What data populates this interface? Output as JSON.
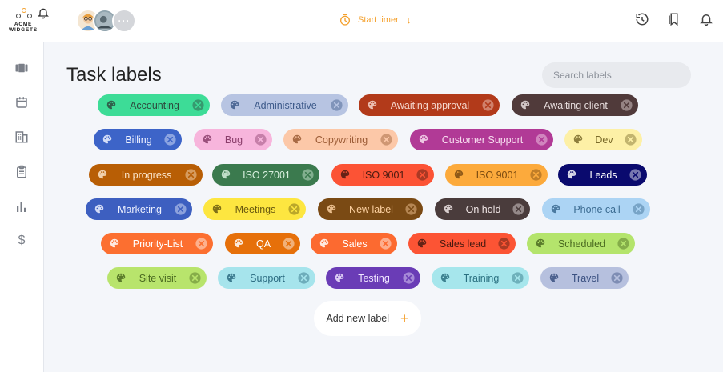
{
  "brand": {
    "line1": "ACME",
    "line2": "WIDGETS"
  },
  "header": {
    "timer_label": "Start timer",
    "avatars_more": "···"
  },
  "page": {
    "title": "Task labels"
  },
  "search": {
    "placeholder": "Search labels"
  },
  "add_label": {
    "text": "Add new label"
  },
  "labels": [
    {
      "name": "Accounting",
      "bg": "#3ddc97",
      "fg": "#2e4a3e"
    },
    {
      "name": "Administrative",
      "bg": "#b7c4e2",
      "fg": "#3d5a8a"
    },
    {
      "name": "Awaiting approval",
      "bg": "#b23a1a",
      "fg": "#f5d6cc"
    },
    {
      "name": "Awaiting client",
      "bg": "#503a3a",
      "fg": "#e8dede"
    },
    {
      "name": "Billing",
      "bg": "#3d64c8",
      "fg": "#eef2ff"
    },
    {
      "name": "Bug",
      "bg": "#f7b5dc",
      "fg": "#8a3d6a"
    },
    {
      "name": "Copywriting",
      "bg": "#fcc8a8",
      "fg": "#9a5a34"
    },
    {
      "name": "Customer Support",
      "bg": "#b13a96",
      "fg": "#f8dff0"
    },
    {
      "name": "Dev",
      "bg": "#fdf0a6",
      "fg": "#7a6a2a"
    },
    {
      "name": "In progress",
      "bg": "#b85e05",
      "fg": "#fbe6cc"
    },
    {
      "name": "ISO 27001",
      "bg": "#3b7a4e",
      "fg": "#d8f0de"
    },
    {
      "name": "ISO 9001",
      "bg": "#fc5335",
      "fg": "#4a1a10"
    },
    {
      "name": "ISO 9001",
      "bg": "#fcaa3c",
      "fg": "#7a4a10"
    },
    {
      "name": "Leads",
      "bg": "#0a0a6e",
      "fg": "#ffffff"
    },
    {
      "name": "Marketing",
      "bg": "#3d5fc0",
      "fg": "#eef2ff"
    },
    {
      "name": "Meetings",
      "bg": "#fde640",
      "fg": "#6a5a10"
    },
    {
      "name": "New label",
      "bg": "#7a4a14",
      "fg": "#fcd0a0"
    },
    {
      "name": "On hold",
      "bg": "#4a3c3c",
      "fg": "#f0e6e6"
    },
    {
      "name": "Phone call",
      "bg": "#acd4f4",
      "fg": "#3a6a90"
    },
    {
      "name": "Priority-List",
      "bg": "#fc6f30",
      "fg": "#ffffff"
    },
    {
      "name": "QA",
      "bg": "#e6700a",
      "fg": "#ffffff"
    },
    {
      "name": "Sales",
      "bg": "#fc6a30",
      "fg": "#ffffff"
    },
    {
      "name": "Sales lead",
      "bg": "#fc5434",
      "fg": "#4a1a10"
    },
    {
      "name": "Scheduled",
      "bg": "#b4e46c",
      "fg": "#4a6a20"
    },
    {
      "name": "Site visit",
      "bg": "#b8e46c",
      "fg": "#4a6a20"
    },
    {
      "name": "Support",
      "bg": "#a6e4ec",
      "fg": "#2a6a80"
    },
    {
      "name": "Testing",
      "bg": "#6a3cb6",
      "fg": "#f0e6ff"
    },
    {
      "name": "Training",
      "bg": "#a6e6ec",
      "fg": "#2a7080"
    },
    {
      "name": "Travel",
      "bg": "#b6c0de",
      "fg": "#3a5080"
    }
  ],
  "icons": {
    "timer": "stopwatch-icon",
    "history": "history-icon",
    "bookmarks": "bookmarks-icon",
    "notifications": "bell-icon",
    "chip_leading": "palette-icon",
    "chip_trailing": "remove-circle-icon",
    "add": "plus-icon",
    "sidebar": [
      "board-icon",
      "calendar-icon",
      "office-building-icon",
      "clipboard-icon",
      "bar-chart-icon",
      "dollar-icon"
    ]
  },
  "colors": {
    "accent": "#f4a02c",
    "page_bg": "#f4f6fa"
  }
}
